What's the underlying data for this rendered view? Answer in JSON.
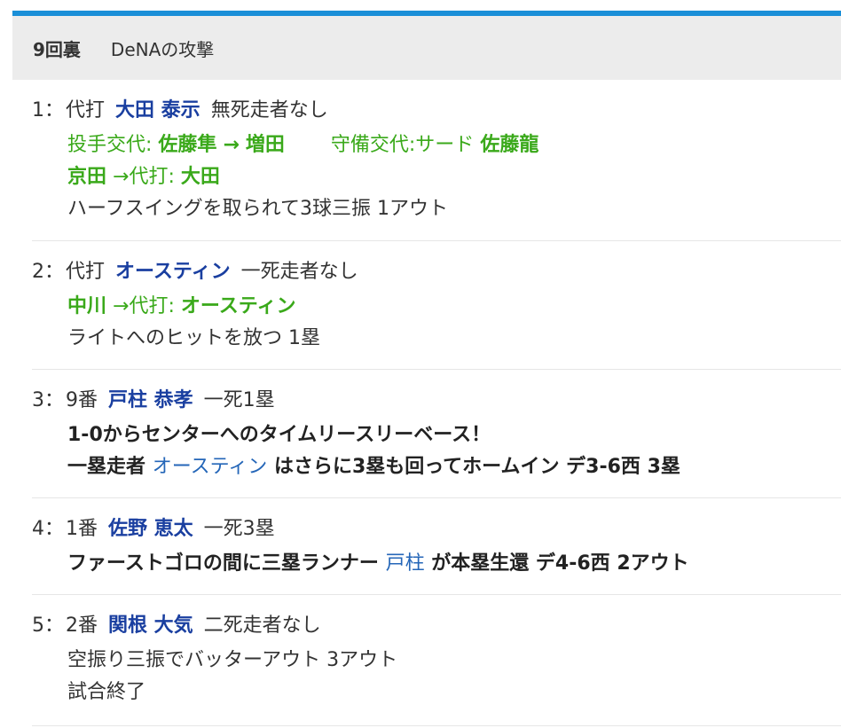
{
  "header": {
    "inning": "9回裏",
    "attack": "DeNAの攻撃"
  },
  "plays": [
    {
      "num": "1：",
      "pos": "代打",
      "player": "大田 泰示",
      "situation": "無死走者なし",
      "change1": {
        "label": "投手交代:",
        "from": "佐藤隼",
        "arrow": "→",
        "to": "増田",
        "def_label": "守備交代:サード",
        "def_player": "佐藤龍"
      },
      "change2": {
        "from": "京田",
        "arrow": "→代打:",
        "to": "大田"
      },
      "result": "ハーフスイングを取られて3球三振 1アウト"
    },
    {
      "num": "2：",
      "pos": "代打",
      "player": "オースティン",
      "situation": "一死走者なし",
      "change1": {
        "from": "中川",
        "arrow": "→代打:",
        "to": "オースティン"
      },
      "result": "ライトへのヒットを放つ 1塁"
    },
    {
      "num": "3：",
      "pos": "9番",
      "player": "戸柱 恭孝",
      "situation": "一死1塁",
      "line1": "1-0からセンターへのタイムリースリーベース！",
      "line2_a": "一塁走者",
      "line2_link": "オースティン",
      "line2_b": "はさらに3塁も回ってホームイン デ3-6西 3塁"
    },
    {
      "num": "4：",
      "pos": "1番",
      "player": "佐野 恵太",
      "situation": "一死3塁",
      "line1_a": "ファーストゴロの間に三塁ランナー",
      "line1_link": "戸柱",
      "line1_b": "が本塁生還 デ4-6西 2アウト"
    },
    {
      "num": "5：",
      "pos": "2番",
      "player": "関根 大気",
      "situation": "二死走者なし",
      "line1": "空振り三振でバッターアウト 3アウト",
      "line2": "試合終了"
    }
  ]
}
